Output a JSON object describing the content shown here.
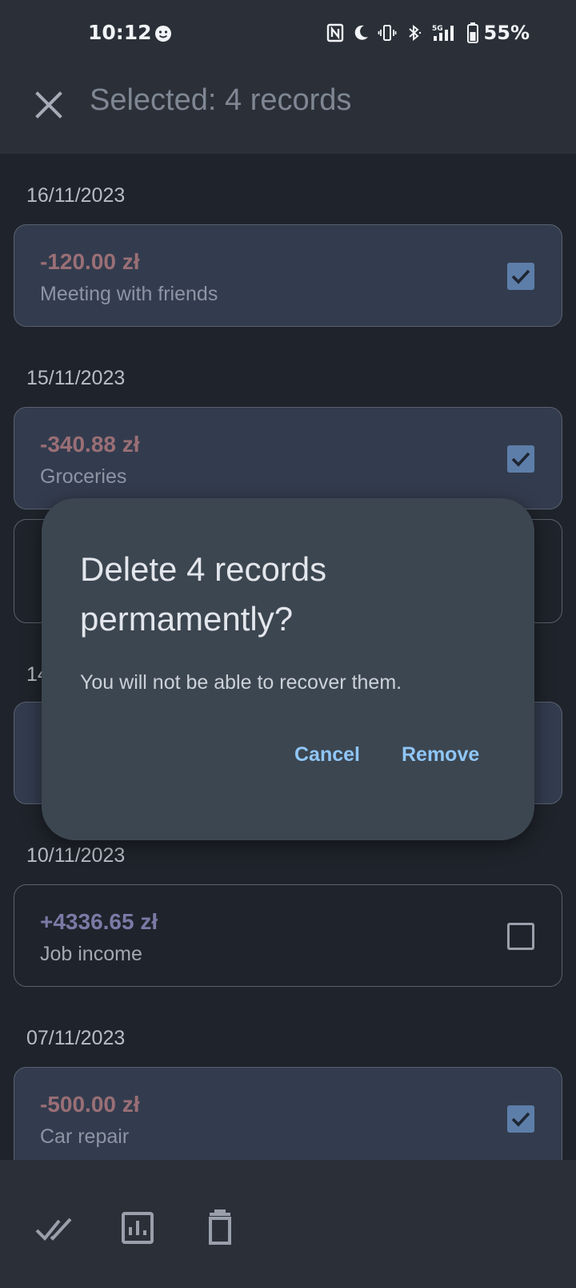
{
  "status_bar": {
    "time": "10:12",
    "battery": "55%",
    "icons": [
      "face-icon",
      "nfc-icon",
      "moon-icon",
      "vibrate-icon",
      "bluetooth-icon",
      "signal-5g-icon",
      "battery-icon"
    ]
  },
  "app_bar": {
    "title": "Selected: 4 records",
    "close_icon": "close-icon"
  },
  "records": {
    "groups": [
      {
        "date": "16/11/2023",
        "items": [
          {
            "amount": "-120.00 zł",
            "description": "Meeting with friends",
            "selected": true
          }
        ]
      },
      {
        "date": "15/11/2023",
        "items": [
          {
            "amount": "-340.88 zł",
            "description": "Groceries",
            "selected": true
          }
        ]
      },
      {
        "date": "14",
        "items": []
      },
      {
        "date": "10/11/2023",
        "items": [
          {
            "amount": "+4336.65 zł",
            "description": "Job income",
            "selected": false
          }
        ]
      },
      {
        "date": "07/11/2023",
        "items": [
          {
            "amount": "-500.00 zł",
            "description": "Car repair",
            "selected": true
          }
        ]
      }
    ]
  },
  "dialog": {
    "title": "Delete 4 records permamently?",
    "body": "You will not be able to recover them.",
    "cancel_label": "Cancel",
    "remove_label": "Remove"
  },
  "bottom_bar": {
    "icons": [
      "select-all-icon",
      "chart-icon",
      "delete-icon"
    ]
  },
  "colors": {
    "background": "#1f232b",
    "bar": "#2b3038",
    "selected_card": "#333c4e",
    "negative_amount": "#9a6f76",
    "positive_amount": "#7a7aa6",
    "checkbox_checked": "#5d7ea9",
    "dialog": "#3c4650",
    "dialog_button": "#8fc6f7"
  }
}
